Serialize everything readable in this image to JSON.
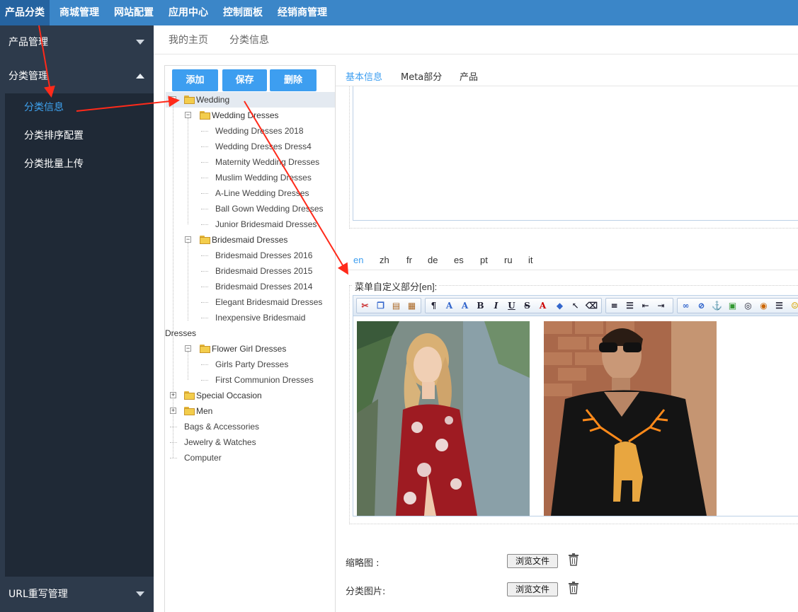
{
  "topnav": [
    "产品分类",
    "商城管理",
    "网站配置",
    "应用中心",
    "控制面板",
    "经销商管理"
  ],
  "sidebar": {
    "section1": "产品管理",
    "section2": "分类管理",
    "items": [
      "分类信息",
      "分类排序配置",
      "分类批量上传"
    ],
    "bottom": "URL重写管理"
  },
  "breadcrumb": [
    "我的主页",
    "分类信息"
  ],
  "buttons": {
    "add": "添加",
    "save": "保存",
    "delete": "删除"
  },
  "tree": {
    "wedding": "Wedding",
    "wedding_dresses": "Wedding Dresses",
    "wd_items": [
      "Wedding Dresses 2018",
      "Wedding Dresses Dress4",
      "Maternity Wedding Dresses",
      "Muslim Wedding Dresses",
      "A-Line Wedding Dresses",
      "Ball Gown Wedding Dresses",
      "Junior Bridesmaid Dresses"
    ],
    "bridesmaid": "Bridesmaid Dresses",
    "bm_items": [
      "Bridesmaid Dresses 2016",
      "Bridesmaid Dresses 2015",
      "Bridesmaid Dresses 2014",
      "Elegant Bridesmaid Dresses",
      "Inexpensive Bridesmaid"
    ],
    "bm_wrap": "Dresses",
    "flower": "Flower Girl Dresses",
    "fg_items": [
      "Girls Party Dresses",
      "First Communion Dresses"
    ],
    "special": "Special Occasion",
    "men": "Men",
    "others": [
      "Bags & Accessories",
      "Jewelry & Watches",
      "Computer"
    ]
  },
  "tabs": [
    "基本信息",
    "Meta部分",
    "产品"
  ],
  "langs": [
    "en",
    "zh",
    "fr",
    "de",
    "es",
    "pt",
    "ru",
    "it"
  ],
  "legend": "菜单自定义部分[en]:",
  "form": {
    "thumb_label": "缩略图 :",
    "image_label": "分类图片:",
    "browse": "浏览文件"
  },
  "colors": {
    "nav": "#3b86c8",
    "sidebar": "#2d3a4b",
    "accent": "#3d9ef0",
    "arrow": "#ff2a1a"
  }
}
